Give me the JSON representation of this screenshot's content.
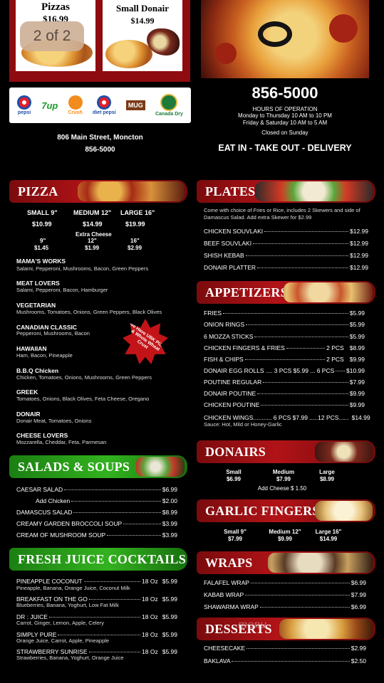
{
  "promo": {
    "pizzas_label": "Pizzas",
    "pizzas_price": "$16.99",
    "donair_label": "Small Donair",
    "donair_price": "$14.99",
    "page_indicator": "2 of 2"
  },
  "logos": [
    "pepsi",
    "7up",
    "Crush",
    "diet pepsi",
    "MUG",
    "Canada Dry"
  ],
  "contact": {
    "phone_big": "856-5000",
    "hours_title": "HOURS OF OPERATION",
    "hours_1": "Monday to Thursday 10 AM to 10 PM",
    "hours_2": "Friday & Saturday 10 AM to 5 AM",
    "closed": "Closed on Sunday",
    "address": "806 Main Street, Moncton",
    "phone_small": "856-5000",
    "tagline": "EAT IN - TAKE OUT - DELIVERY"
  },
  "pizza": {
    "title": "PIZZA",
    "sizes": [
      {
        "label": "SMALL 9\"",
        "price": "$10.99"
      },
      {
        "label": "MEDIUM 12\"",
        "price": "$14.99"
      },
      {
        "label": "LARGE 16\"",
        "price": "$19.99"
      }
    ],
    "extra_cheese_title": "Extra Cheese",
    "extra_cheese": [
      {
        "label": "9\"",
        "price": "$1.45"
      },
      {
        "label": "12\"",
        "price": "$1.99"
      },
      {
        "label": "16\"",
        "price": "$2.99"
      }
    ],
    "items": [
      {
        "name": "MAMA'S WORKS",
        "desc": "Salami, Pepperoni, Mushrooms, Bacon, Green Peppers"
      },
      {
        "name": "MEAT LOVERS",
        "desc": "Salami, Pepperoni, Bacon, Hamburger"
      },
      {
        "name": "VEGETARIAN",
        "desc": "Mushrooms, Tomatoes, Onions, Green Peppers, Black Olives"
      },
      {
        "name": "CANADIAN CLASSIC",
        "desc": "Pepperoni, Mushrooms, Bacon"
      },
      {
        "name": "HAWAIIAN",
        "desc": "Ham, Bacon, Pineapple"
      },
      {
        "name": "B.B.Q Chicken",
        "desc": "Chicken, Tomatoes, Onions, Mushrooms, Green Peppers"
      },
      {
        "name": "GREEK",
        "desc": "Tomatoes, Onions, Black Olives, Feta Cheese, Oregano"
      },
      {
        "name": "DONAIR",
        "desc": "Donair Meat, Tomatoes, Onions"
      },
      {
        "name": "CHEESE LOVERS",
        "desc": "Mozzarella, Cheddar, Feta, Parmesan"
      }
    ],
    "star_text": "We Have UBK PIZZA & Whole Wheat Crust"
  },
  "salads": {
    "title": "SALADS & SOUPS",
    "items": [
      {
        "name": "CAESAR SALAD",
        "price": "$6.99"
      },
      {
        "name": "Add Chicken",
        "price": "$2.00"
      },
      {
        "name": "DAMASCUS SALAD",
        "price": "$8.99"
      },
      {
        "name": "CREAMY GARDEN BROCCOLI SOUP",
        "price": "$3.99"
      },
      {
        "name": "CREAM OF MUSHROOM SOUP",
        "price": "$3.99"
      }
    ]
  },
  "juices": {
    "title": "FRESH JUICE COCKTAILS",
    "items": [
      {
        "name": "PINEAPPLE COCONUT",
        "size": "18 Oz",
        "price": "$5.99",
        "desc": "Pineapple, Banana, Orange Juice, Coconut Milk"
      },
      {
        "name": "BREAKFAST ON THE GO",
        "size": "18 Oz",
        "price": "$5.99",
        "desc": "Blueberries, Banana, Yoghurt, Low Fat Milk"
      },
      {
        "name": "DR : JUICE",
        "size": "18 Oz",
        "price": "$5.99",
        "desc": "Carrot, Ginger, Lemon, Apple, Celery"
      },
      {
        "name": "SIMPLY PURE",
        "size": "18 Oz",
        "price": "$5.99",
        "desc": "Orange Juice, Carrot, Apple, Pineapple"
      },
      {
        "name": "STRAWBERRY SUNRISE",
        "size": "18 Oz",
        "price": "$5.99",
        "desc": "Strawberries, Banana, Yoghurt, Orange Juice"
      }
    ]
  },
  "plates": {
    "title": "PLATES",
    "note": "Come with choice of Fries or Rice, includes 2 Skewers and side of Damascus Salad. Add extra Skewer for $2.99",
    "items": [
      {
        "name": "CHICKEN SOUVLAKI",
        "price": "$12.99"
      },
      {
        "name": "BEEF SOUVLAKI",
        "price": "$12.99"
      },
      {
        "name": "SHISH KEBAB",
        "price": "$12.99"
      },
      {
        "name": "DONAIR PLATTER",
        "price": "$12.99"
      }
    ]
  },
  "appetizers": {
    "title": "APPETIZERS",
    "items": [
      {
        "name": "FRIES",
        "price": "$5.99"
      },
      {
        "name": "ONION RINGS",
        "price": "$5.99"
      },
      {
        "name": "6 MOZZA STICKS",
        "price": "$5.99"
      },
      {
        "name": "CHICKEN FINGERS & FRIES",
        "qty": "2 PCS",
        "price": "$8.99"
      },
      {
        "name": "FISH & CHIPS",
        "qty": "2 PCS",
        "price": "$9.99"
      },
      {
        "name": "DONAIR EGG ROLLS .... 3 PCS  $5.99 ... 6 PCS",
        "price": "$10.99"
      },
      {
        "name": "POUTINE REGULAR",
        "price": "$7.99"
      },
      {
        "name": "DONAIR POUTINE",
        "price": "$9.99"
      },
      {
        "name": "CHICKEN POUTINE",
        "price": "$9.99"
      },
      {
        "name": "CHICKEN WINGS........... 6 PCS $7.99 .....12 PCS......",
        "price": "$14.99"
      }
    ],
    "wings_sauce": "Sauce:  Hot, Mild or Honey-Garlic"
  },
  "donairs": {
    "title": "DONAIRS",
    "sizes": [
      {
        "label": "Small",
        "price": "$6.99"
      },
      {
        "label": "Medium",
        "price": "$7.99"
      },
      {
        "label": "Large",
        "price": "$8.99"
      }
    ],
    "add_cheese": "Add Cheese $ 1.50"
  },
  "garlic": {
    "title": "GARLIC FINGERS",
    "sizes": [
      {
        "label": "Small 9\"",
        "price": "$7.99"
      },
      {
        "label": "Medium 12\"",
        "price": "$9.99"
      },
      {
        "label": "Large 16\"",
        "price": "$14.99"
      }
    ]
  },
  "wraps": {
    "title": "WRAPS",
    "items": [
      {
        "name": "FALAFEL WRAP",
        "price": "$6.99"
      },
      {
        "name": "KABAB WRAP",
        "price": "$7.99"
      },
      {
        "name": "SHAWARMA WRAP",
        "price": "$6.99"
      }
    ]
  },
  "desserts": {
    "title": "DESSERTS",
    "items": [
      {
        "name": "CHEESECAKE",
        "price": "$2.99"
      },
      {
        "name": "BAKLAVA",
        "price": "$2.50"
      }
    ]
  },
  "watermark": "menu"
}
